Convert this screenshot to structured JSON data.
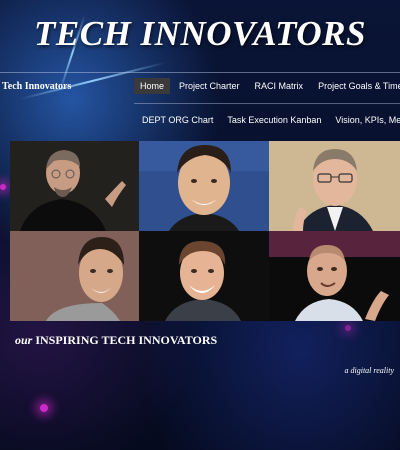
{
  "banner": {
    "title": "TECH INNOVATORS"
  },
  "header": {
    "site_name": "Tech Innovators"
  },
  "nav": {
    "row1": [
      {
        "label": "Home",
        "active": true
      },
      {
        "label": "Project Charter"
      },
      {
        "label": "RACI Matrix"
      },
      {
        "label": "Project Goals & Timeline"
      }
    ],
    "row2": [
      {
        "label": "DEPT ORG Chart"
      },
      {
        "label": "Task Execution Kanban"
      },
      {
        "label": "Vision, KPIs, Metrics"
      }
    ]
  },
  "gallery": {
    "photos": [
      {
        "icon": "portrait-bald-glasses-black-turtleneck",
        "bg": "#1c1c1c"
      },
      {
        "icon": "portrait-dark-hair-smiling",
        "bg": "#2f4f8f"
      },
      {
        "icon": "portrait-gray-hair-glasses-suit",
        "bg": "#c9b08a"
      },
      {
        "icon": "portrait-dark-hair-gray-sweater",
        "bg": "#7a5a55"
      },
      {
        "icon": "portrait-curly-hair-smiling",
        "bg": "#0e0e0e"
      },
      {
        "icon": "portrait-bald-presenting",
        "bg": "#0b0b0b"
      }
    ]
  },
  "content": {
    "tagline_prefix": "our",
    "tagline_main": "INSPIRING TECH INNOVATORS",
    "subtagline": "a digital reality"
  },
  "colors": {
    "background": "#070d24",
    "active_nav": "#3a3a3a",
    "text": "#ffffff",
    "accent_glow": "#c92cc6"
  }
}
